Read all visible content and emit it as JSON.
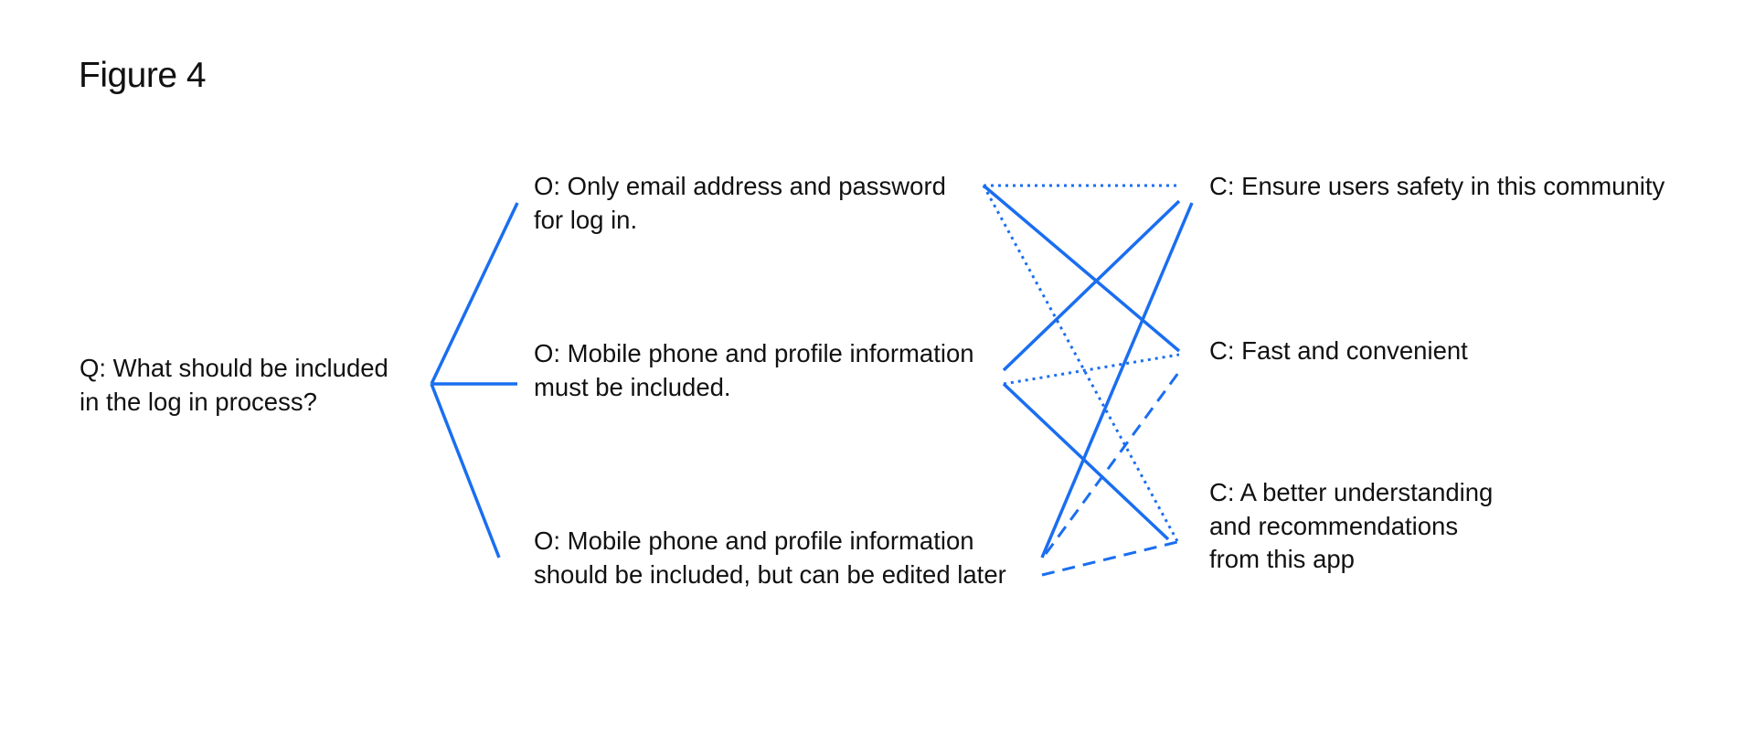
{
  "figure": {
    "title": "Figure 4",
    "line_color": "#1a6ef0"
  },
  "question": {
    "lines": [
      "Q: What should be included",
      "in the log in process?"
    ]
  },
  "options": [
    {
      "lines": [
        "O: Only email address and password",
        "for log in."
      ]
    },
    {
      "lines": [
        "O: Mobile phone and profile information",
        "must be included."
      ]
    },
    {
      "lines": [
        "O: Mobile phone and profile information",
        "should be included, but can be edited later"
      ]
    }
  ],
  "criteria": [
    {
      "lines": [
        "C: Ensure users safety in this community"
      ]
    },
    {
      "lines": [
        "C: Fast and convenient"
      ]
    },
    {
      "lines": [
        "C: A better understanding",
        "and recommendations",
        "from this app"
      ]
    }
  ],
  "links": [
    {
      "option": 1,
      "criterion": 1,
      "style": "dotted"
    },
    {
      "option": 1,
      "criterion": 2,
      "style": "solid"
    },
    {
      "option": 1,
      "criterion": 3,
      "style": "dotted"
    },
    {
      "option": 2,
      "criterion": 1,
      "style": "solid"
    },
    {
      "option": 2,
      "criterion": 2,
      "style": "dotted"
    },
    {
      "option": 2,
      "criterion": 3,
      "style": "solid"
    },
    {
      "option": 3,
      "criterion": 1,
      "style": "solid"
    },
    {
      "option": 3,
      "criterion": 2,
      "style": "dashed"
    },
    {
      "option": 3,
      "criterion": 3,
      "style": "dashed"
    }
  ]
}
